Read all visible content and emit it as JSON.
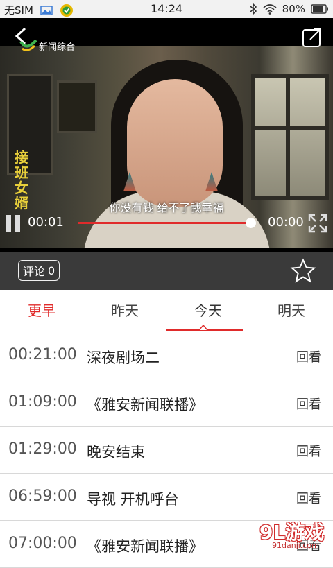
{
  "status_bar": {
    "carrier": "无SIM",
    "time": "14:24",
    "battery": "80%"
  },
  "player": {
    "channel": "新闻综合",
    "show_title": [
      "接",
      "班",
      "女",
      "婿"
    ],
    "subtitle": "你没有钱 给不了我幸福",
    "current_time": "00:01",
    "total_time": "00:00",
    "progress": 0.98,
    "progress_color": "#e02b2b"
  },
  "actions": {
    "comment_label": "评论",
    "comment_count": "0"
  },
  "tabs": [
    {
      "label": "更早"
    },
    {
      "label": "昨天"
    },
    {
      "label": "今天"
    },
    {
      "label": "明天"
    }
  ],
  "schedule": [
    {
      "time": "00:21:00",
      "program": "深夜剧场二",
      "action": "回看"
    },
    {
      "time": "01:09:00",
      "program": "《雅安新闻联播》",
      "action": "回看"
    },
    {
      "time": "01:29:00",
      "program": "晚安结束",
      "action": "回看"
    },
    {
      "time": "06:59:00",
      "program": "导视 开机呼台",
      "action": "回看"
    },
    {
      "time": "07:00:00",
      "program": "《雅安新闻联播》",
      "action": "回看"
    }
  ],
  "watermark": {
    "main": "9L游戏",
    "sub": "91danji.com"
  },
  "colors": {
    "accent": "#e02b2b",
    "action_bar": "#3a3a3a"
  }
}
